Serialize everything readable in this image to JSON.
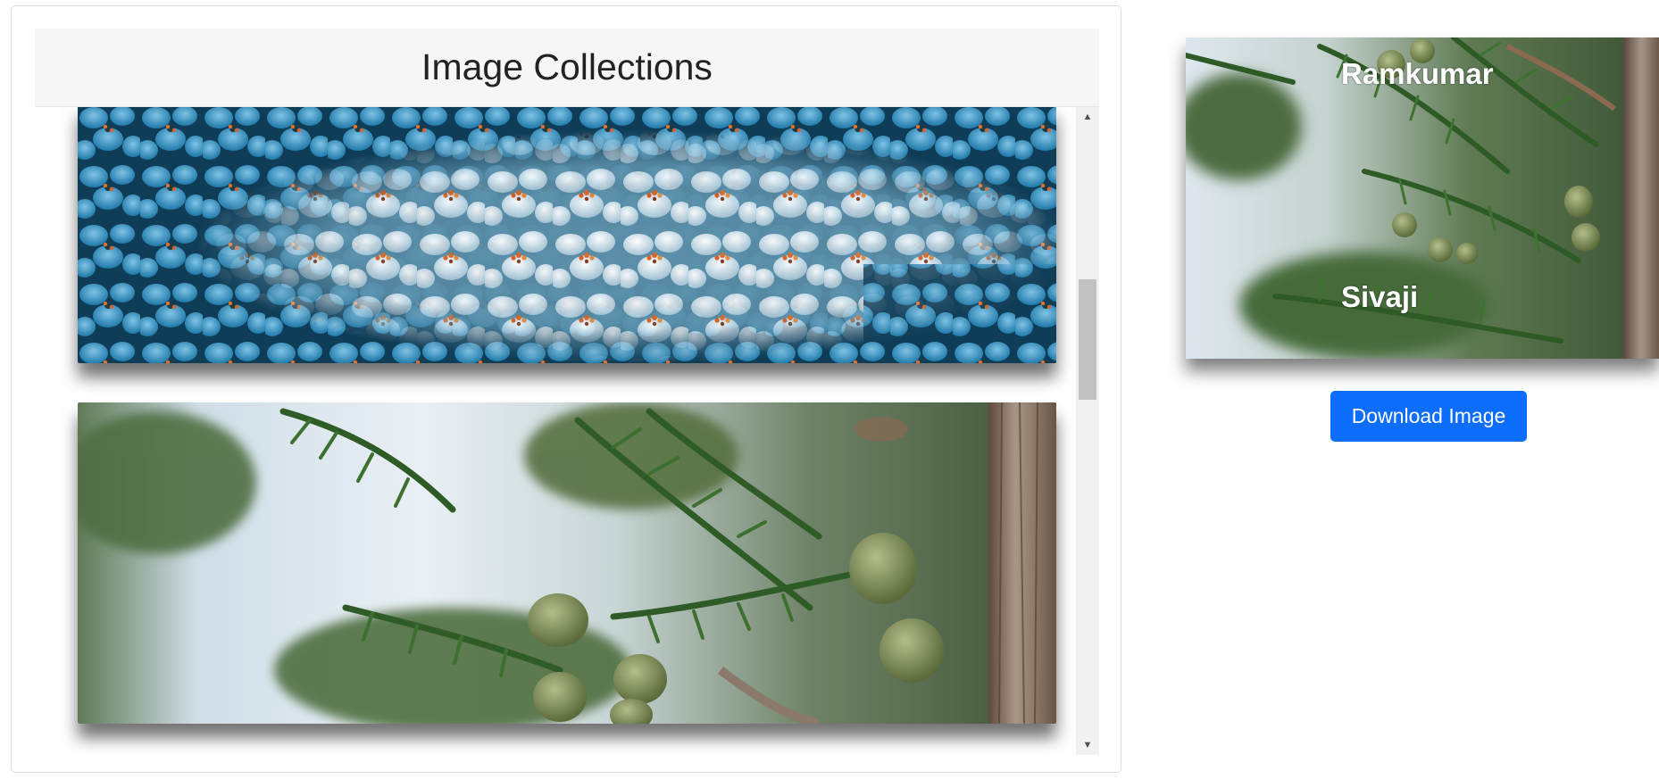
{
  "header": {
    "title": "Image Collections"
  },
  "gallery": {
    "items": [
      {
        "name": "blue-white-flowers"
      },
      {
        "name": "evergreen-branch-with-berries"
      }
    ]
  },
  "preview": {
    "overlay_texts": [
      "Ramkumar",
      "Sivaji"
    ]
  },
  "actions": {
    "download_label": "Download Image"
  },
  "scrollbar": {
    "up_glyph": "▲",
    "down_glyph": "▼",
    "position_fraction": 0.3
  },
  "colors": {
    "primary_button": "#0d6efd",
    "header_bg": "#f6f6f6"
  }
}
